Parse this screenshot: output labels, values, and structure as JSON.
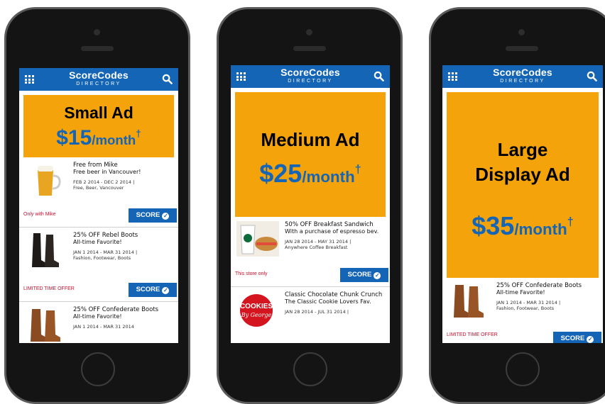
{
  "colors": {
    "brand_blue": "#1565b7",
    "ad_orange": "#f4a30a",
    "offer_red": "#c8102e"
  },
  "header": {
    "brand": "ScoreCodes",
    "sub": "DIRECTORY",
    "menu_icon": "grid-icon",
    "search_icon": "search-icon"
  },
  "score_label": "SCORE",
  "phones": [
    {
      "ad": {
        "name": "Small Ad",
        "price": "$15",
        "unit": "/month",
        "dagger": "†"
      },
      "deals": [
        {
          "title": "Free from Mike",
          "subtitle": "Free beer in Vancouver!",
          "dates": "FEB 2 2014 - DEC 2 2014",
          "tags": "Free, Beer, Vancouver",
          "note": "Only with Mike",
          "image": "beer-mug"
        },
        {
          "title": "25% OFF Rebel Boots",
          "subtitle": "All-time Favorite!",
          "dates": "JAN 1 2014 - MAR 31 2014",
          "tags": "Fashion, Footwear, Boots",
          "note": "LIMITED TIME OFFER",
          "image": "black-boots"
        },
        {
          "title": "25% OFF Confederate Boots",
          "subtitle": "All-time Favorite!",
          "dates": "JAN 1 2014 - MAR 31 2014",
          "tags": "",
          "note": "",
          "image": "brown-boots"
        }
      ]
    },
    {
      "ad": {
        "name": "Medium Ad",
        "price": "$25",
        "unit": "/month",
        "dagger": "†"
      },
      "deals": [
        {
          "title": "50% OFF Breakfast Sandwich",
          "subtitle": "With a purchase of espresso bev.",
          "dates": "JAN 28 2014 - MAY 31 2014",
          "tags": "Anywhere Coffee Breakfast",
          "note": "This store only",
          "image": "coffee-sandwich"
        },
        {
          "title": "Classic Chocolate Chunk Crunch",
          "subtitle": "The Classic Cookie Lovers Fav.",
          "dates": "JAN 28 2014 - JUL 31 2014",
          "tags": "",
          "note": "",
          "image": "cookies-logo"
        }
      ]
    },
    {
      "ad": {
        "name": "Large Display Ad",
        "price": "$35",
        "unit": "/month",
        "dagger": "†"
      },
      "deals": [
        {
          "title": "25% OFF Confederate Boots",
          "subtitle": "All-time Favorite!",
          "dates": "JAN 1 2014 - MAR 31 2014",
          "tags": "Fashion, Footwear, Boots",
          "note": "LIMITED TIME OFFER",
          "image": "brown-boots"
        }
      ]
    }
  ]
}
